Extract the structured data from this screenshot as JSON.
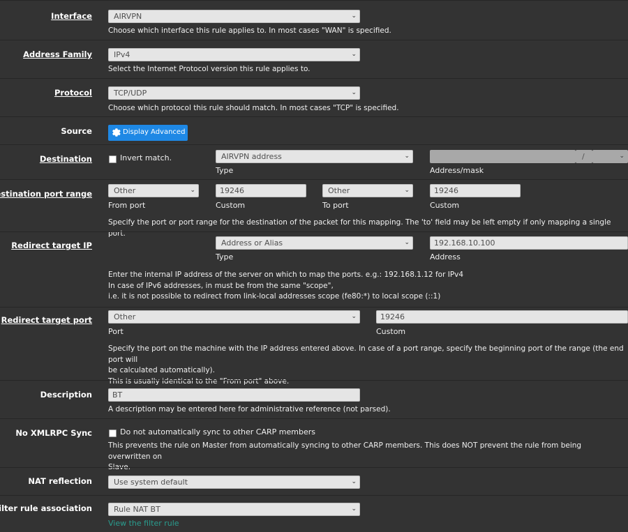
{
  "interface": {
    "label": "Interface",
    "value": "AIRVPN",
    "help": "Choose which interface this rule applies to. In most cases \"WAN\" is specified."
  },
  "address_family": {
    "label": "Address Family",
    "value": "IPv4",
    "help": "Select the Internet Protocol version this rule applies to."
  },
  "protocol": {
    "label": "Protocol",
    "value": "TCP/UDP",
    "help": "Choose which protocol this rule should match. In most cases \"TCP\" is specified."
  },
  "source": {
    "label": "Source",
    "button": "Display Advanced",
    "button_icon": "gear-icon",
    "button_color": "#1e88e5"
  },
  "destination": {
    "label": "Destination",
    "invert_label": "Invert match.",
    "type_value": "AIRVPN address",
    "type_caption": "Type",
    "mask_separator": "/",
    "address_caption": "Address/mask"
  },
  "dest_port_range": {
    "label": "Destination port range",
    "from_port_value": "Other",
    "from_port_caption": "From port",
    "from_custom_value": "19246",
    "from_custom_caption": "Custom",
    "to_port_value": "Other",
    "to_port_caption": "To port",
    "to_custom_value": "19246",
    "to_custom_caption": "Custom",
    "help": "Specify the port or port range for the destination of the packet for this mapping. The 'to' field may be left empty if only mapping a single port."
  },
  "redirect_ip": {
    "label": "Redirect target IP",
    "type_value": "Address or Alias",
    "type_caption": "Type",
    "address_value": "192.168.10.100",
    "address_caption": "Address",
    "help_1": "Enter the internal IP address of the server on which to map the ports. e.g.: 192.168.1.12 for IPv4",
    "help_2": "In case of IPv6 addresses, in must be from the same \"scope\",",
    "help_3": "i.e. it is not possible to redirect from link-local addresses scope (fe80:*) to local scope (::1)"
  },
  "redirect_port": {
    "label": "Redirect target port",
    "port_value": "Other",
    "port_caption": "Port",
    "custom_value": "19246",
    "custom_caption": "Custom",
    "help_1": "Specify the port on the machine with the IP address entered above. In case of a port range, specify the beginning port of the range (the end port will",
    "help_2": "be calculated automatically).",
    "help_3": "This is usually identical to the \"From port\" above."
  },
  "description": {
    "label": "Description",
    "value": "BT",
    "help": "A description may be entered here for administrative reference (not parsed)."
  },
  "xmlrpc": {
    "label": "No XMLRPC Sync",
    "checkbox_label": "Do not automatically sync to other CARP members",
    "help_1": "This prevents the rule on Master from automatically syncing to other CARP members. This does NOT prevent the rule from being overwritten on",
    "help_2": "Slave."
  },
  "nat_reflection": {
    "label": "NAT reflection",
    "value": "Use system default"
  },
  "filter_rule": {
    "label": "Filter rule association",
    "value": "Rule NAT BT",
    "link": "View the filter rule",
    "link_color": "#2a9d8f"
  }
}
